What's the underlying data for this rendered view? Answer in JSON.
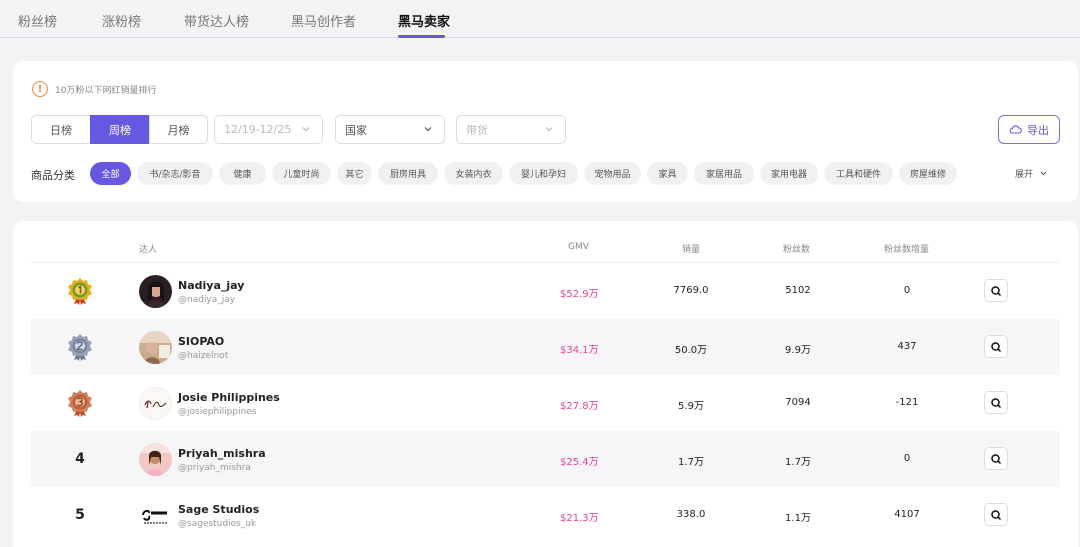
{
  "tabs": [
    {
      "label": "粉丝榜"
    },
    {
      "label": "涨粉榜"
    },
    {
      "label": "带货达人榜"
    },
    {
      "label": "黑马创作者"
    },
    {
      "label": "黑马卖家"
    }
  ],
  "active_tab_index": 4,
  "notice": {
    "text": "10万粉以下网红销量排行",
    "icon": "warning-circle-icon"
  },
  "period": {
    "day": "日榜",
    "week": "周榜",
    "month": "月榜",
    "selected": "周榜"
  },
  "date_select": {
    "value": "12/19-12/25"
  },
  "country_select": {
    "value": "国家"
  },
  "goods_select": {
    "value": "带货"
  },
  "export": {
    "label": "导出",
    "icon": "cloud-download-icon"
  },
  "category": {
    "label": "商品分类",
    "chips": [
      "全部",
      "书/杂志/影音",
      "健康",
      "儿童时尚",
      "其它",
      "厨房用具",
      "女装内衣",
      "婴儿和孕妇",
      "宠物用品",
      "家具",
      "家居用品",
      "家用电器",
      "工具和硬件",
      "房屋维修"
    ],
    "selected": "全部",
    "expand_label": "展开"
  },
  "table": {
    "headers": {
      "creator": "达人",
      "gmv": "GMV",
      "sales": "销量",
      "fans": "粉丝数",
      "fans_increase": "粉丝数增量"
    },
    "rows": [
      {
        "rank": "1",
        "rank_badge": "gold-medal-icon",
        "name": "Nadiya_jay",
        "handle": "@nadiya_jay",
        "gmv": "$52.9万",
        "sales": "7769.0",
        "fans": "5102",
        "fans_increase": "0"
      },
      {
        "rank": "2",
        "rank_badge": "silver-medal-icon",
        "name": "SIOPAO",
        "handle": "@haizelnot",
        "gmv": "$34.1万",
        "sales": "50.0万",
        "fans": "9.9万",
        "fans_increase": "437"
      },
      {
        "rank": "3",
        "rank_badge": "bronze-medal-icon",
        "name": "Josie Philippines",
        "handle": "@josiephilippines",
        "gmv": "$27.8万",
        "sales": "5.9万",
        "fans": "7094",
        "fans_increase": "-121"
      },
      {
        "rank": "4",
        "name": "Priyah_mishra",
        "handle": "@priyah_mishra",
        "gmv": "$25.4万",
        "sales": "1.7万",
        "fans": "1.7万",
        "fans_increase": "0"
      },
      {
        "rank": "5",
        "name": "Sage Studios",
        "handle": "@sagestudios_uk",
        "gmv": "$21.3万",
        "sales": "338.0",
        "fans": "1.1万",
        "fans_increase": "4107"
      }
    ]
  },
  "colors": {
    "accent": "#6658e0",
    "gmv": "#e0449a",
    "gold": "#e3b21a",
    "silver": "#9aa3b5",
    "bronze": "#d0805a"
  }
}
